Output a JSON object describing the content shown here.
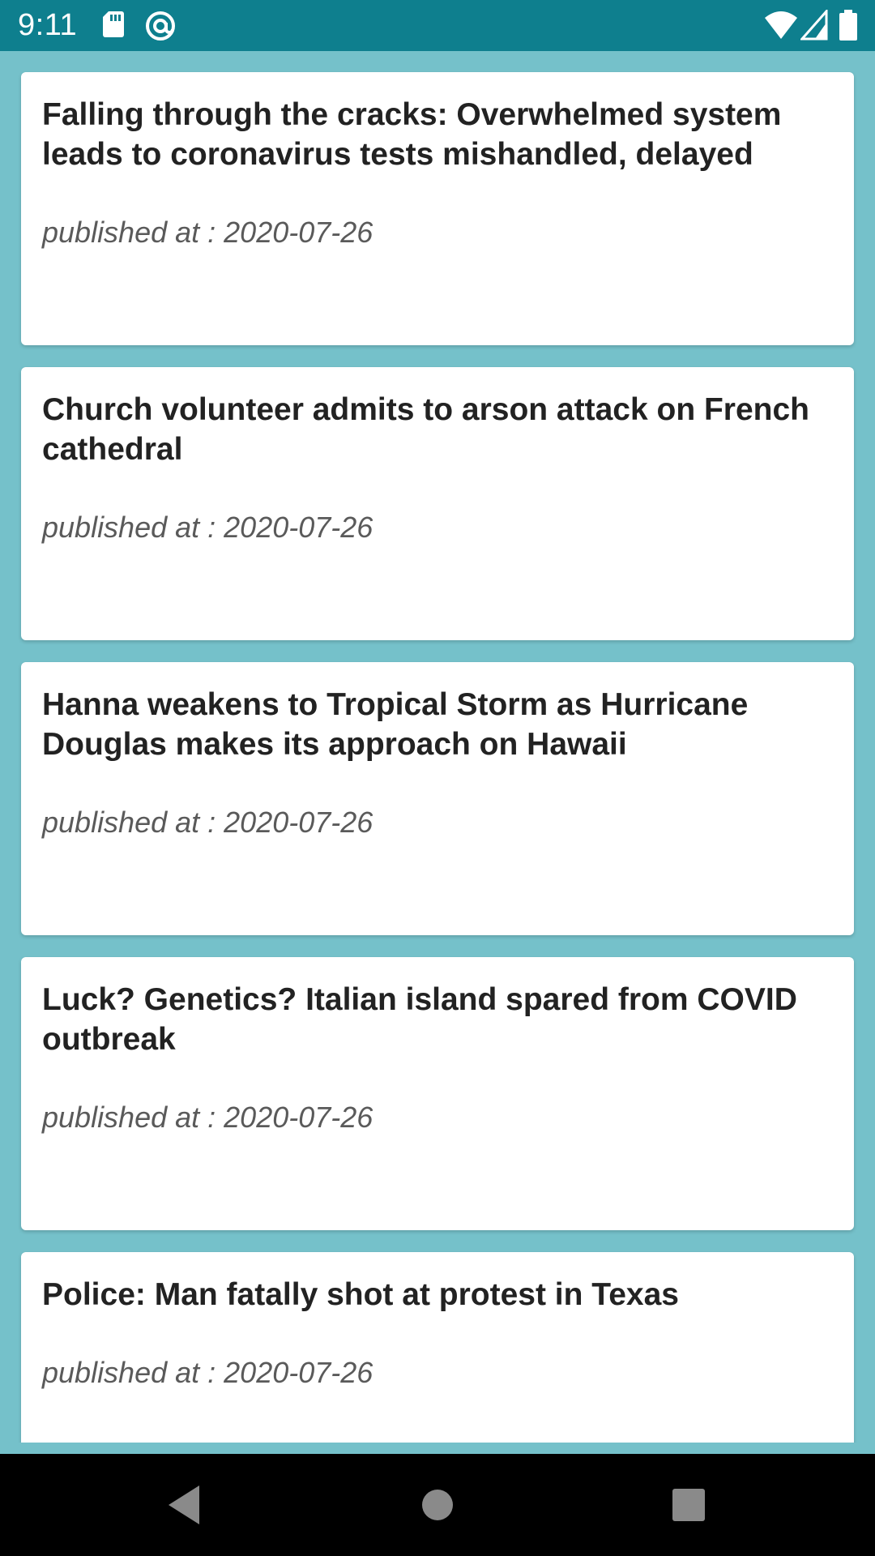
{
  "status_bar": {
    "time": "9:11",
    "icons": [
      "sd-card-icon",
      "at-sign-icon",
      "wifi-icon",
      "cell-signal-icon",
      "battery-icon"
    ]
  },
  "colors": {
    "status_bar": "#0e7f8e",
    "background": "#75c1ca",
    "card": "#ffffff",
    "nav_bar": "#000000"
  },
  "articles": [
    {
      "title": "Falling through the cracks: Overwhelmed system leads to coronavirus tests mishandled, delayed",
      "date": "published at : 2020-07-26"
    },
    {
      "title": "Church volunteer admits to arson attack on French cathedral",
      "date": "published at : 2020-07-26"
    },
    {
      "title": "Hanna weakens to Tropical Storm as Hurricane Douglas makes its approach on Hawaii",
      "date": "published at : 2020-07-26"
    },
    {
      "title": "Luck? Genetics? Italian island spared from COVID outbreak",
      "date": "published at : 2020-07-26"
    },
    {
      "title": "Police: Man fatally shot at protest in Texas",
      "date": "published at : 2020-07-26"
    }
  ],
  "nav_bar": {
    "buttons": [
      "back-icon",
      "home-icon",
      "recents-icon"
    ]
  }
}
